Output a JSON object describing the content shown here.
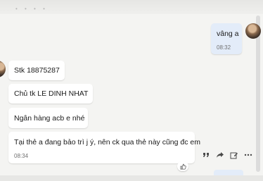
{
  "conversation": {
    "outgoing": {
      "text": "vâng a",
      "time": "08:32"
    },
    "incoming": [
      {
        "text": "Stk 18875287"
      },
      {
        "text": "Chủ tk LE DINH NHAT"
      },
      {
        "text": "Ngân hàng acb e nhé"
      },
      {
        "text": "Tại thẻ a đang bảo trì j ý, nên ck qua thẻ này cũng đc em",
        "time": "08:34"
      }
    ]
  },
  "message_actions": [
    "quote-icon",
    "forward-icon",
    "edit-icon",
    "more-icon"
  ],
  "reaction": {
    "icon": "thumbs-up-icon"
  },
  "colors": {
    "chat_background": "#f4f4f2",
    "incoming_bubble": "#ffffff",
    "outgoing_bubble": "#e3ecf9",
    "action_icon": "#4a4a4a"
  }
}
